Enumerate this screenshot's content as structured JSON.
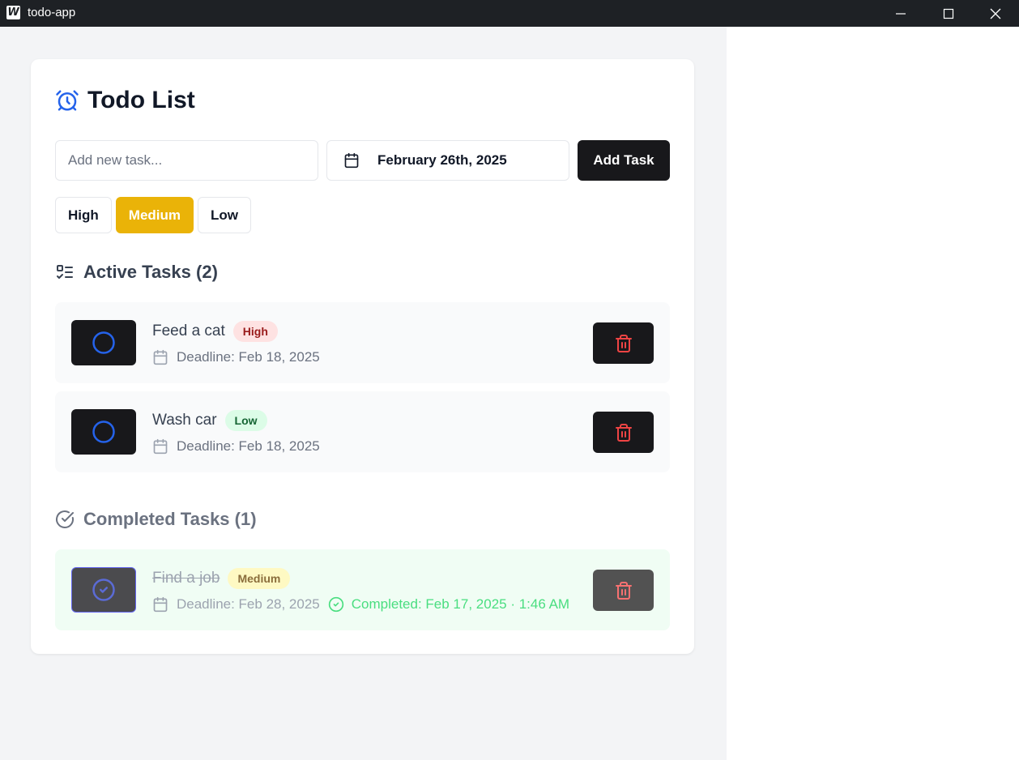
{
  "window": {
    "title": "todo-app",
    "logo_letter": "W",
    "icons": {
      "minimize": "minimize-icon",
      "maximize": "maximize-icon",
      "close": "close-icon"
    }
  },
  "header": {
    "title": "Todo List",
    "icon": "alarm-clock-icon"
  },
  "form": {
    "task_placeholder": "Add new task...",
    "task_value": "",
    "date_value": "February 26th, 2025",
    "add_label": "Add Task"
  },
  "priorities": {
    "options": [
      "High",
      "Medium",
      "Low"
    ],
    "selected": "Medium"
  },
  "active": {
    "heading": "Active Tasks (2)",
    "tasks": [
      {
        "name": "Feed a cat",
        "priority": "High",
        "deadline": "Deadline: Feb 18, 2025"
      },
      {
        "name": "Wash car",
        "priority": "Low",
        "deadline": "Deadline: Feb 18, 2025"
      }
    ]
  },
  "completed": {
    "heading": "Completed Tasks (1)",
    "tasks": [
      {
        "name": "Find a job",
        "priority": "Medium",
        "deadline": "Deadline: Feb 28, 2025",
        "completed": "Completed: Feb 17, 2025 · 1:46 AM"
      }
    ]
  },
  "colors": {
    "accent_blue": "#2563eb",
    "selected_priority": "#eab308",
    "delete_red": "#ef4444",
    "completed_green": "#4ade80"
  }
}
